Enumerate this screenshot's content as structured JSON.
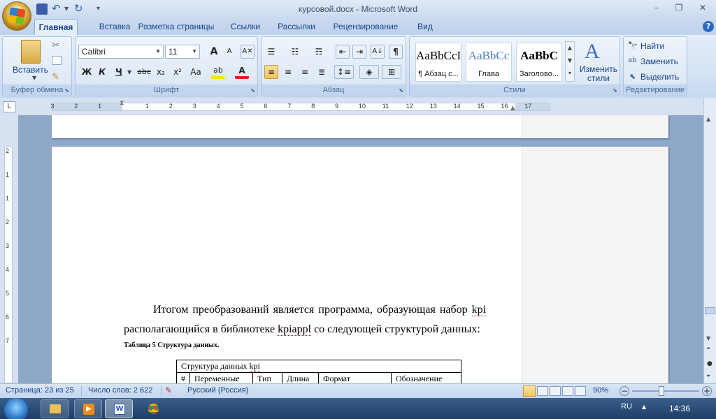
{
  "window": {
    "title": "курсовой.docx - Microsoft Word",
    "minimize": "–",
    "restore": "❐",
    "close": "✕"
  },
  "tabs": [
    "Главная",
    "Вставка",
    "Разметка страницы",
    "Ссылки",
    "Рассылки",
    "Рецензирование",
    "Вид"
  ],
  "ribbon": {
    "clipboard": {
      "paste": "Вставить",
      "label": "Буфер обмена"
    },
    "font": {
      "name": "Calibri",
      "size": "11",
      "label": "Шрифт",
      "bold": "Ж",
      "italic": "К",
      "underline": "Ч",
      "strike": "abc",
      "sub": "x₂",
      "sup": "x²",
      "case": "Аа",
      "grow": "A",
      "shrink": "A"
    },
    "paragraph": {
      "label": "Абзац",
      "pilcrow": "¶"
    },
    "styles": {
      "label": "Стили",
      "items": [
        {
          "sample": "AaBbCcI",
          "name": "¶ Абзац с..."
        },
        {
          "sample": "AaBbCc",
          "name": "Глава"
        },
        {
          "sample": "AaBbC",
          "name": "Заголово..."
        }
      ],
      "change": "Изменить стили"
    },
    "editing": {
      "label": "Редактирование",
      "find": "Найти",
      "replace": "Заменить",
      "select": "Выделить"
    }
  },
  "ruler": {
    "numbers": [
      "3",
      "2",
      "1",
      "1",
      "2",
      "3",
      "4",
      "5",
      "6",
      "7",
      "8",
      "9",
      "10",
      "11",
      "12",
      "13",
      "14",
      "15",
      "16",
      "17"
    ],
    "vnumbers": [
      "2",
      "1",
      "1",
      "2",
      "3",
      "4",
      "5",
      "6",
      "7"
    ]
  },
  "document": {
    "para_line1": "Итогом преобразований является программа, образующая набор ",
    "kpi1": "kpi",
    "para_line2a": "располагающийся в библиотеке ",
    "kpiappl": "kpiappl",
    "para_line2b": " со следующей структурой данных:",
    "caption": "Таблица 5   Структура данных.",
    "table": {
      "title_prefix": "Структура данных ",
      "title_kpi": "kpi",
      "headers": [
        "#",
        "Переменные",
        "Тип",
        "Длина",
        "Формат",
        "Обозначение"
      ]
    }
  },
  "status": {
    "page": "Страница: 23 из 25",
    "words": "Число слов: 2 622",
    "language": "Русский (Россия)",
    "zoom": "90%"
  },
  "taskbar": {
    "lang": "RU",
    "time": "14:36"
  }
}
